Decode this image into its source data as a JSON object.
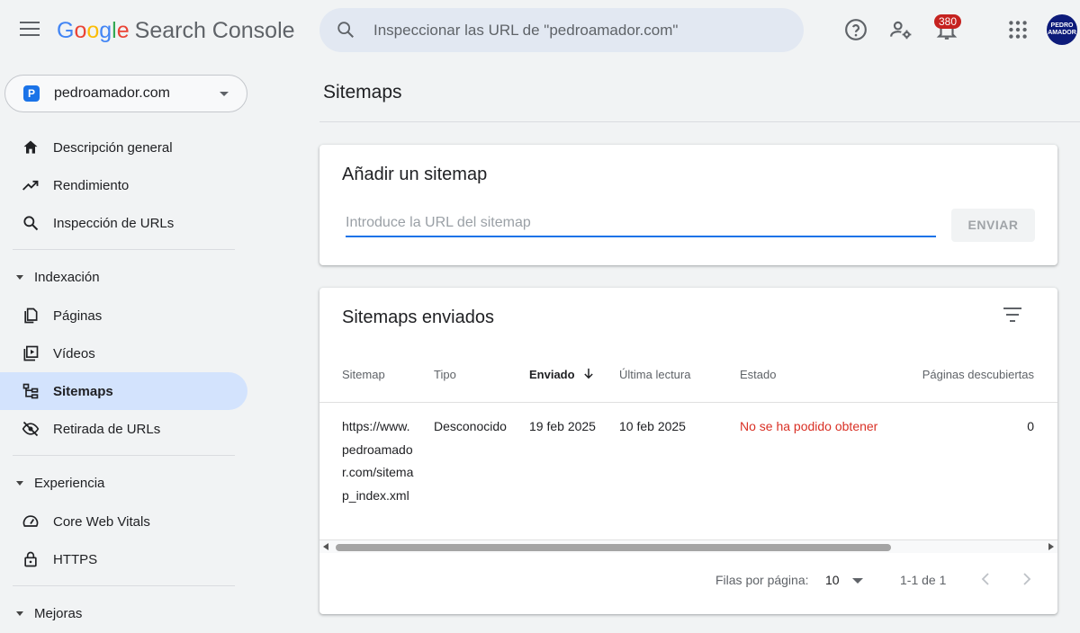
{
  "app": {
    "logo_google": [
      "G",
      "o",
      "o",
      "g",
      "l",
      "e"
    ],
    "product": "Search Console",
    "search_placeholder": "Inspeccionar las URL de \"pedroamador.com\"",
    "notifications_count": "380",
    "avatar_text": "PEDRO AMADOR"
  },
  "property": {
    "icon_letter": "P",
    "name": "pedroamador.com"
  },
  "sidebar": {
    "items": [
      {
        "label": "Descripción general"
      },
      {
        "label": "Rendimiento"
      },
      {
        "label": "Inspección de URLs"
      }
    ],
    "indexing": {
      "title": "Indexación",
      "items": [
        {
          "label": "Páginas"
        },
        {
          "label": "Vídeos"
        },
        {
          "label": "Sitemaps"
        },
        {
          "label": "Retirada de URLs"
        }
      ]
    },
    "experience": {
      "title": "Experiencia",
      "items": [
        {
          "label": "Core Web Vitals"
        },
        {
          "label": "HTTPS"
        }
      ]
    },
    "improvements": {
      "title": "Mejoras"
    }
  },
  "page": {
    "title": "Sitemaps"
  },
  "add_sitemap": {
    "title": "Añadir un sitemap",
    "placeholder": "Introduce la URL del sitemap",
    "button": "ENVIAR"
  },
  "submitted": {
    "title": "Sitemaps enviados",
    "columns": [
      "Sitemap",
      "Tipo",
      "Enviado",
      "Última lectura",
      "Estado",
      "Páginas descubiertas"
    ],
    "rows": [
      {
        "sitemap": "https://www.pedroamador.com/sitemap_index.xml",
        "type": "Desconocido",
        "submitted": "19 feb 2025",
        "last_read": "10 feb 2025",
        "status": "No se ha podido obtener",
        "pages": "0"
      }
    ],
    "pagination": {
      "rows_label": "Filas por página:",
      "rows_value": "10",
      "range": "1-1 de 1"
    }
  },
  "colors": {
    "accent": "#1a73e8",
    "active_nav": "#d3e3fd",
    "error": "#d93025",
    "badge": "#c5221f"
  }
}
